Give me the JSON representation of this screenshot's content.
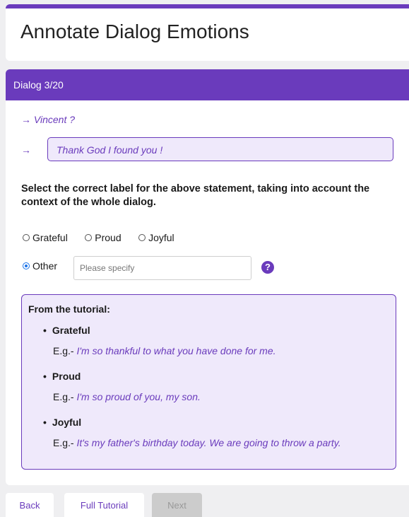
{
  "page": {
    "title": "Annotate Dialog Emotions"
  },
  "dialog": {
    "progress_label": "Dialog 3/20",
    "turns": [
      {
        "arrow": "→",
        "text": "Vincent ?"
      },
      {
        "arrow": "→",
        "text": "Thank God I found you !"
      }
    ]
  },
  "question": {
    "instruction": "Select the correct label for the above statement, taking into account the context of the whole dialog.",
    "options": [
      {
        "label": "Grateful",
        "selected": false
      },
      {
        "label": "Proud",
        "selected": false
      },
      {
        "label": "Joyful",
        "selected": false
      },
      {
        "label": "Other",
        "selected": true
      }
    ],
    "other_input": {
      "value": "",
      "placeholder": "Please specify"
    },
    "help_icon": {
      "icon": "question-circle-icon",
      "glyph": "?"
    }
  },
  "tutorial": {
    "heading": "From the tutorial:",
    "example_prefix": "E.g.-",
    "items": [
      {
        "label": "Grateful",
        "example": "I'm so thankful to what you have done for me."
      },
      {
        "label": "Proud",
        "example": "I'm so proud of you, my son."
      },
      {
        "label": "Joyful",
        "example": "It's my father's birthday today. We are going to throw a party."
      }
    ]
  },
  "nav": {
    "back_label": "Back",
    "full_tutorial_label": "Full Tutorial",
    "next_label": "Next",
    "next_enabled": false
  },
  "colors": {
    "accent": "#6a3bbc",
    "accent_light": "#efe9fb",
    "radio_selected": "#1a73e8",
    "page_background": "#efeff1",
    "disabled_button": "#cccccc"
  }
}
